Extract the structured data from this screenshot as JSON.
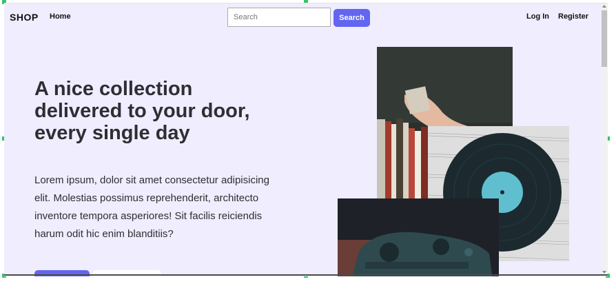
{
  "navbar": {
    "brand": "SHOP",
    "home": "Home",
    "search_placeholder": "Search",
    "search_button": "Search",
    "login": "Log In",
    "register": "Register"
  },
  "hero": {
    "title": "A nice collection delivered to your door, every single day",
    "text": "Lorem ipsum, dolor sit amet consectetur adipisicing elit. Molestias possimus reprehenderit, architecto inventore tempora asperiores! Sit facilis reiciendis harum odit hic enim blanditiis?"
  },
  "images": [
    {
      "name": "hand-pulling-book-from-shelf"
    },
    {
      "name": "vinyl-record-on-sheet-music"
    },
    {
      "name": "game-controller-in-dim-light"
    }
  ],
  "colors": {
    "accent": "#6366f1",
    "page_background": "#efedfe",
    "text": "#2e2e33"
  }
}
